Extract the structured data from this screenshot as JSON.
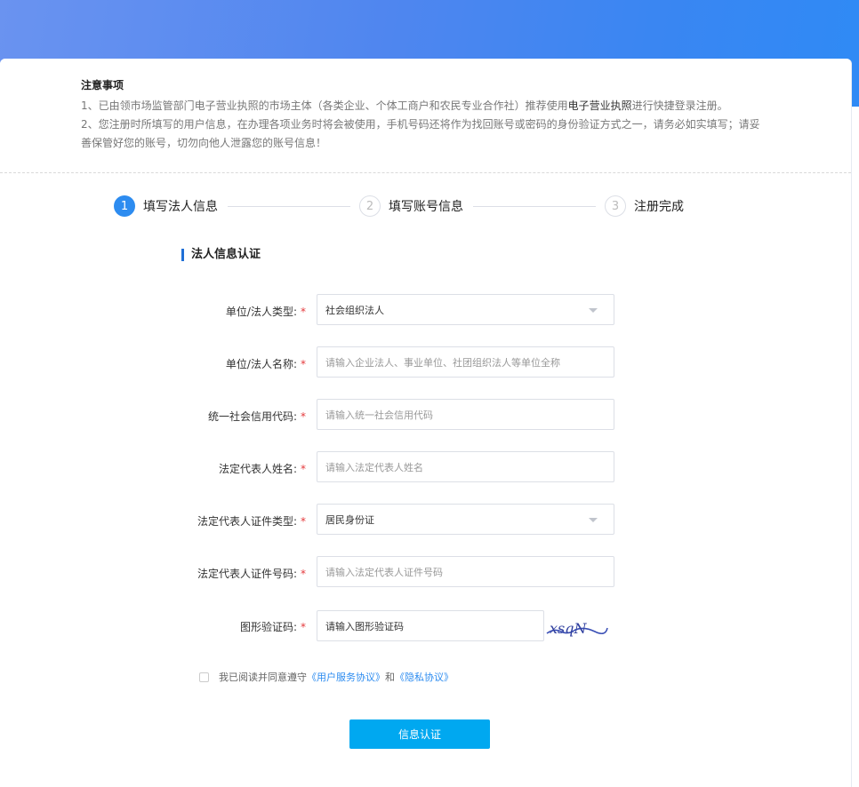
{
  "notice": {
    "title": "注意事项",
    "line1_prefix": "1、已由领市场监管部门电子营业执照的市场主体（各类企业、个体工商户和农民专业合作社）推荐使用",
    "line1_highlight": "电子营业执照",
    "line1_suffix": "进行快捷登录注册。",
    "line2": "2、您注册时所填写的用户信息，在办理各项业务时将会被使用，手机号码还将作为找回账号或密码的身份验证方式之一，请务必如实填写；请妥",
    "line3": "善保管好您的账号，切勿向他人泄露您的账号信息！"
  },
  "steps": [
    {
      "number": "1",
      "label": "填写法人信息",
      "state": "active"
    },
    {
      "number": "2",
      "label": "填写账号信息",
      "state": "todo"
    },
    {
      "number": "3",
      "label": "注册完成",
      "state": "todo"
    }
  ],
  "section_title": "法人信息认证",
  "form": {
    "required_mark": "*",
    "unit_type": {
      "label": "单位/法人类型:",
      "value": "社会组织法人"
    },
    "unit_name": {
      "label": "单位/法人名称:",
      "placeholder": "请输入企业法人、事业单位、社团组织法人等单位全称"
    },
    "credit_code": {
      "label": "统一社会信用代码:",
      "placeholder": "请输入统一社会信用代码"
    },
    "rep_name": {
      "label": "法定代表人姓名:",
      "placeholder": "请输入法定代表人姓名"
    },
    "id_type": {
      "label": "法定代表人证件类型:",
      "value": "居民身份证"
    },
    "id_number": {
      "label": "法定代表人证件号码:",
      "placeholder": "请输入法定代表人证件号码"
    },
    "captcha": {
      "label": "图形验证码:",
      "placeholder": "请输入图形验证码",
      "image_text": "xsqN"
    }
  },
  "agreement": {
    "prefix": "我已阅读并同意遵守",
    "link1": "《用户服务协议》",
    "middle": "和",
    "link2": "《隐私协议》"
  },
  "submit_label": "信息认证",
  "colors": {
    "primary": "#2d8cf0",
    "button": "#00a8f0",
    "required": "#e4393c",
    "section_bar": "#1f6fd6"
  }
}
